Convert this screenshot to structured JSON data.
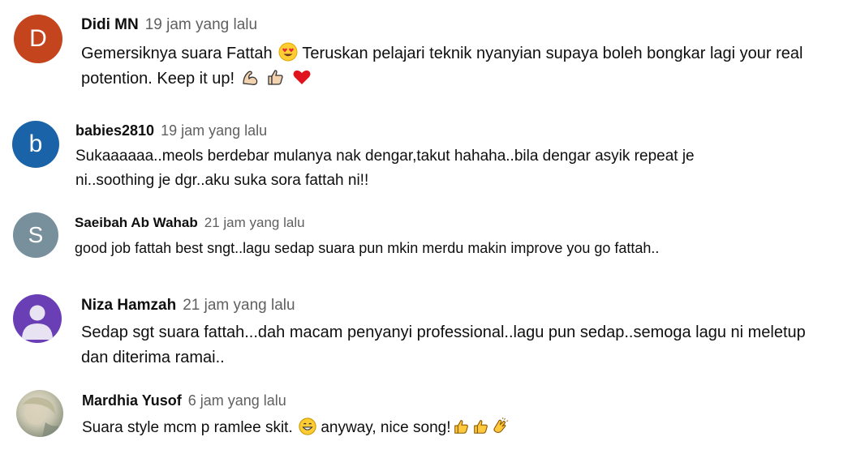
{
  "comments": [
    {
      "author": "Didi MN",
      "time": "19 jam yang lalu",
      "avatar_letter": "D",
      "avatar_color": "#c4441e",
      "line1": "Gemersiknya suara Fattah",
      "line1b": "Teruskan pelajari teknik nyanyian supaya boleh bongkar lagi your real",
      "line2": "potention. Keep it up!",
      "emojis": [
        "heart-eyes-emoji",
        "flexed-biceps-emoji",
        "thumbs-up-emoji",
        "red-heart-emoji"
      ]
    },
    {
      "author": "babies2810",
      "time": "19 jam yang lalu",
      "avatar_letter": "b",
      "avatar_color": "#1a63a8",
      "line1": "Sukaaaaaa..meols berdebar mulanya nak dengar,takut hahaha..bila dengar asyik repeat je",
      "line2": "ni..soothing je dgr..aku suka sora fattah ni!!"
    },
    {
      "author": "Saeibah Ab Wahab",
      "time": "21 jam yang lalu",
      "avatar_letter": "S",
      "avatar_color": "#78909c",
      "line1": "good job fattah best sngt..lagu sedap suara pun mkin merdu makin improve you go fattah.."
    },
    {
      "author": "Niza Hamzah",
      "time": "21 jam yang lalu",
      "avatar_color": "#6a3fb5",
      "avatar_icon": "default-user-icon",
      "line1": "Sedap sgt suara fattah...dah macam penyanyi professional..lagu pun sedap..semoga lagu ni meletup",
      "line2": "dan diterima ramai.."
    },
    {
      "author": "Mardhia Yusof",
      "time": "6 jam yang lalu",
      "avatar_icon": "photo-avatar",
      "line1": "Suara style mcm p ramlee skit.",
      "line1b": "anyway, nice song!",
      "emojis": [
        "grinning-emoji",
        "thumbs-up-emoji",
        "thumbs-up-emoji",
        "clapping-hands-emoji"
      ]
    }
  ]
}
